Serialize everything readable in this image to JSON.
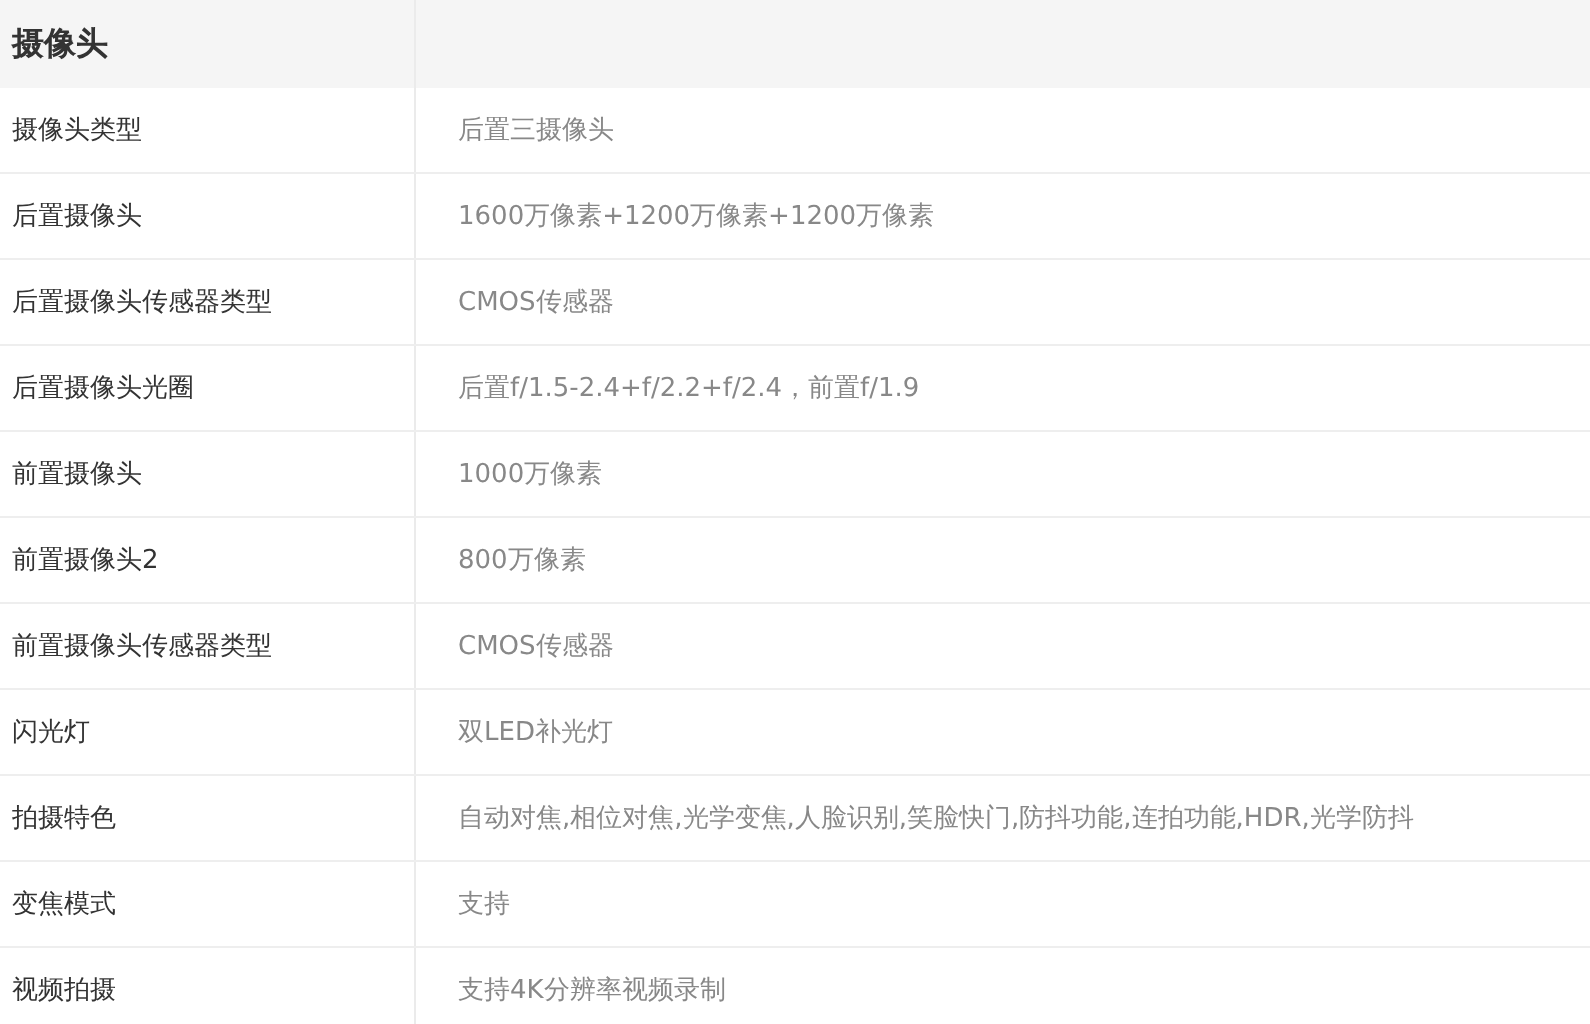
{
  "section_title": "摄像头",
  "rows": [
    {
      "label": "摄像头类型",
      "value": "后置三摄像头"
    },
    {
      "label": "后置摄像头",
      "value": "1600万像素+1200万像素+1200万像素"
    },
    {
      "label": "后置摄像头传感器类型",
      "value": "CMOS传感器"
    },
    {
      "label": "后置摄像头光圈",
      "value": "后置f/1.5-2.4+f/2.2+f/2.4，前置f/1.9"
    },
    {
      "label": "前置摄像头",
      "value": "1000万像素"
    },
    {
      "label": "前置摄像头2",
      "value": "800万像素"
    },
    {
      "label": "前置摄像头传感器类型",
      "value": "CMOS传感器"
    },
    {
      "label": "闪光灯",
      "value": "双LED补光灯"
    },
    {
      "label": "拍摄特色",
      "value": "自动对焦,相位对焦,光学变焦,人脸识别,笑脸快门,防抖功能,连拍功能,HDR,光学防抖"
    },
    {
      "label": "变焦模式",
      "value": "支持"
    },
    {
      "label": "视频拍摄",
      "value": "支持4K分辨率视频录制"
    }
  ]
}
